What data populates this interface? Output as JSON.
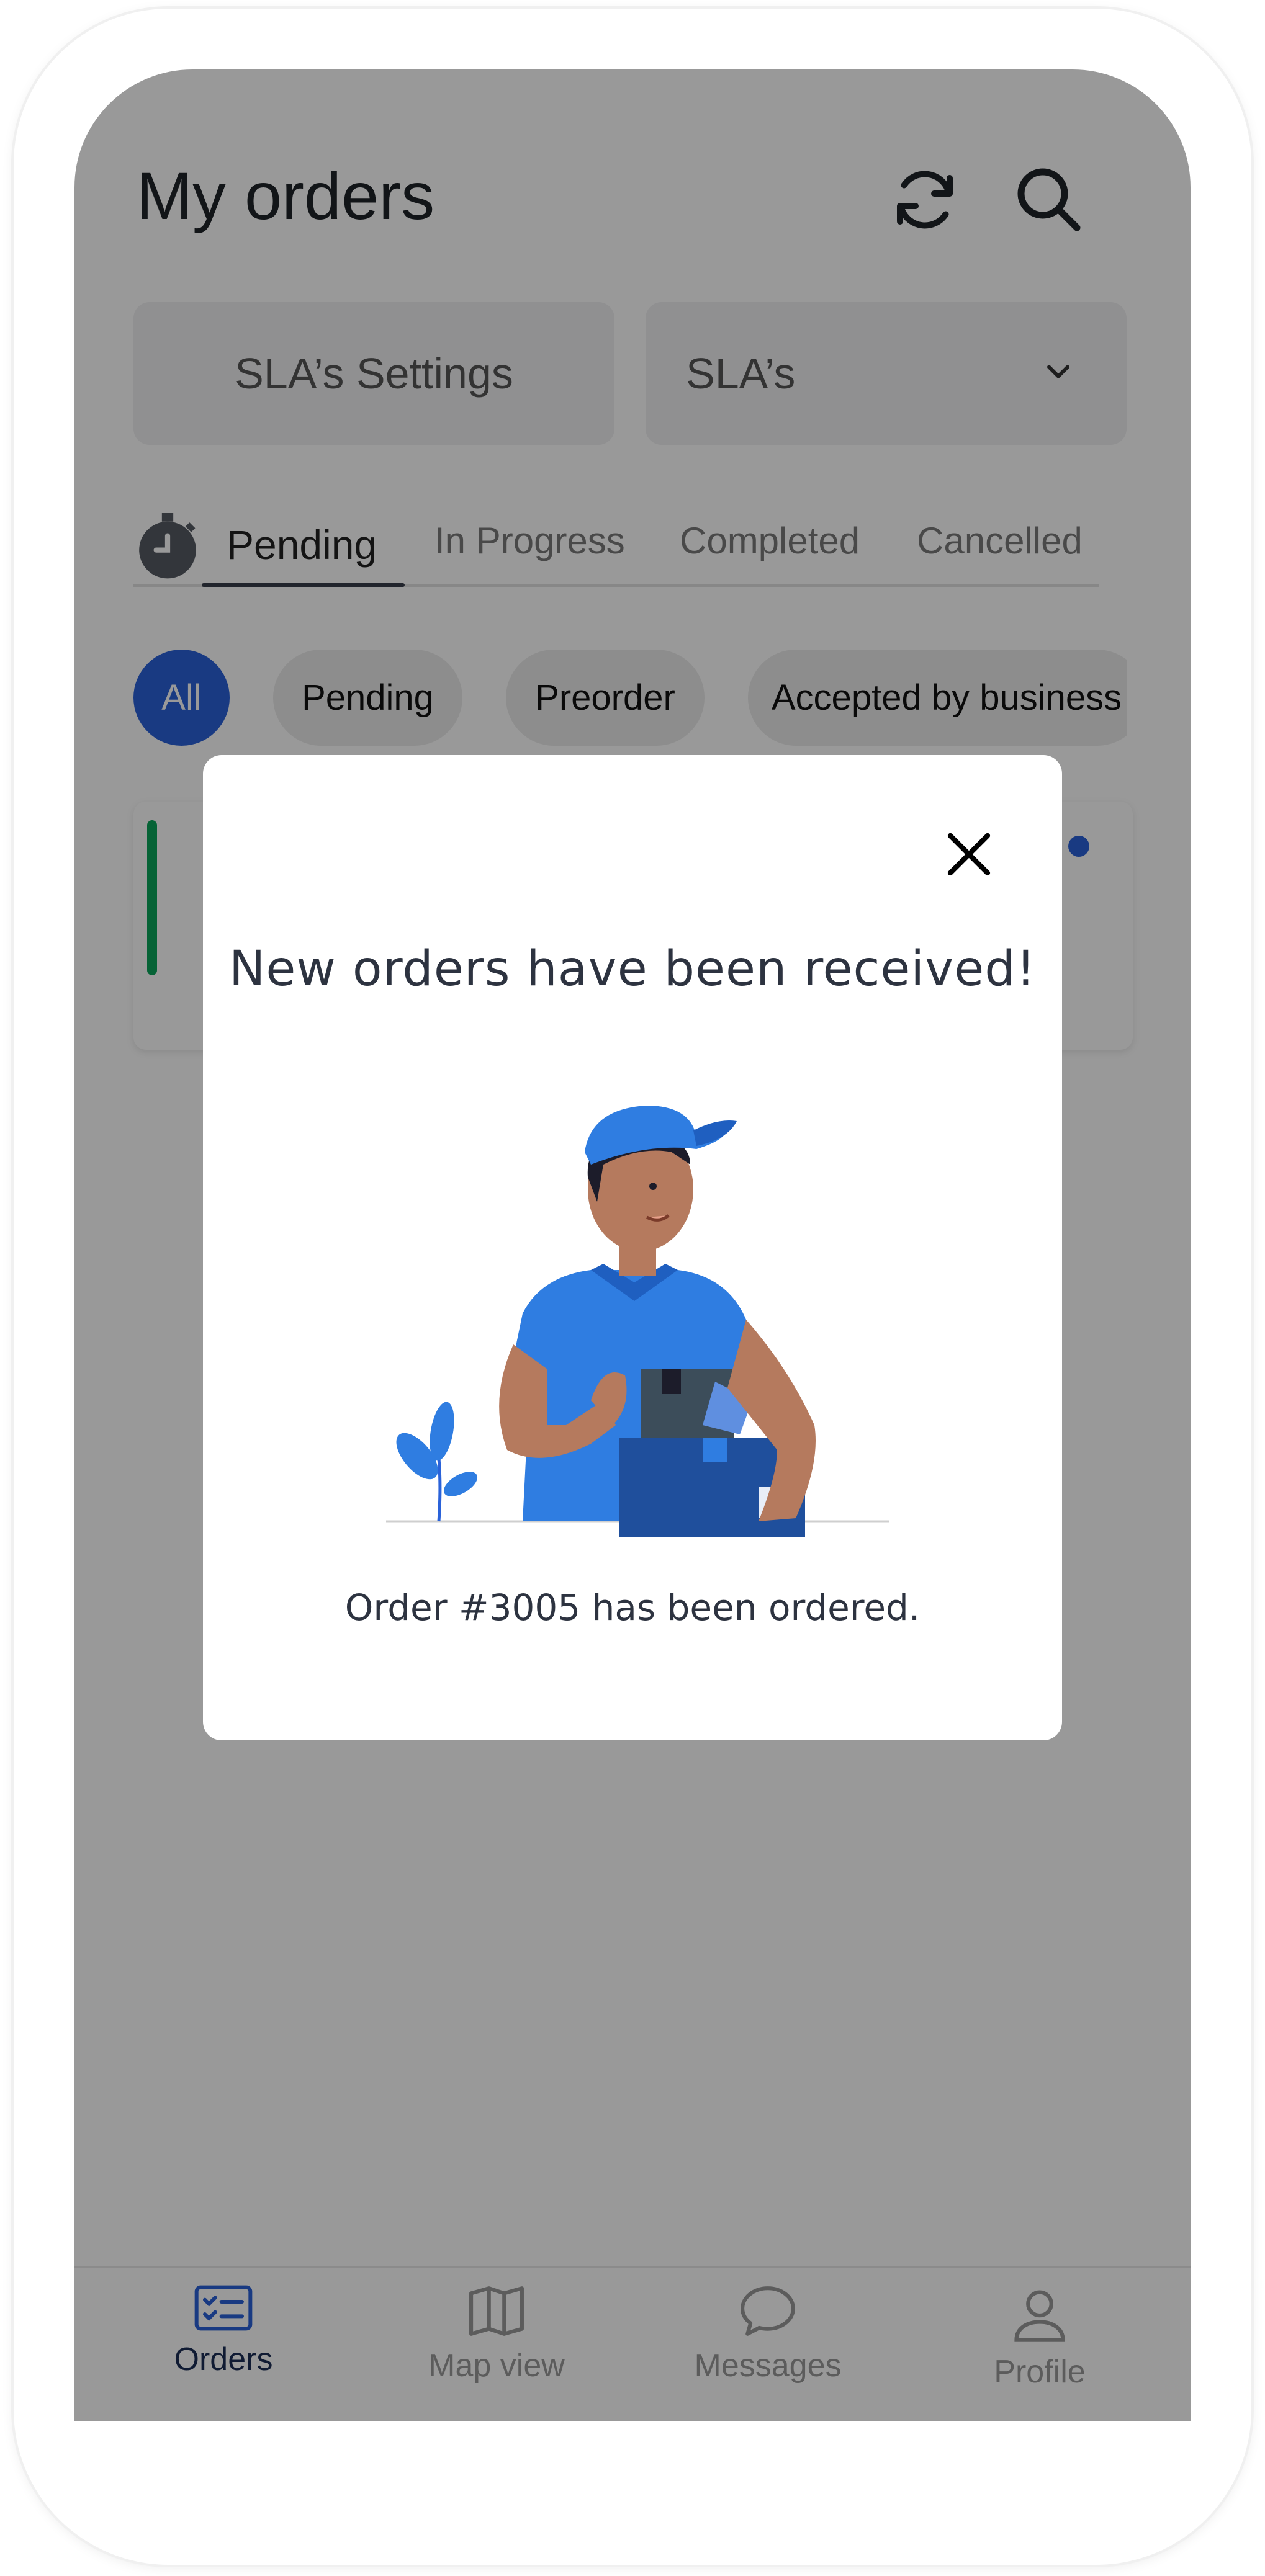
{
  "header": {
    "title": "My orders",
    "refresh_icon": "refresh-icon",
    "search_icon": "search-icon"
  },
  "sla": {
    "settings_label": "SLA’s Settings",
    "select_value": "SLA’s"
  },
  "tabs": [
    {
      "label": "Pending",
      "active": true
    },
    {
      "label": "In Progress",
      "active": false
    },
    {
      "label": "Completed",
      "active": false
    },
    {
      "label": "Cancelled",
      "active": false
    }
  ],
  "chips": [
    {
      "label": "All",
      "active": true
    },
    {
      "label": "Pending",
      "active": false
    },
    {
      "label": "Preorder",
      "active": false
    },
    {
      "label": "Accepted by business",
      "active": false
    }
  ],
  "bottom_nav": [
    {
      "label": "Orders",
      "icon": "orders-list-icon",
      "active": true
    },
    {
      "label": "Map view",
      "icon": "map-icon",
      "active": false
    },
    {
      "label": "Messages",
      "icon": "chat-bubble-icon",
      "active": false
    },
    {
      "label": "Profile",
      "icon": "user-icon",
      "active": false
    }
  ],
  "modal": {
    "title": "New orders have been received!",
    "message": "Order #3005 has been ordered.",
    "illustration": "delivery-person-illustration"
  },
  "colors": {
    "accent": "#2a62d9",
    "status_bar_green": "#0aa55a",
    "overlay": "rgba(0,0,0,0.40)"
  }
}
